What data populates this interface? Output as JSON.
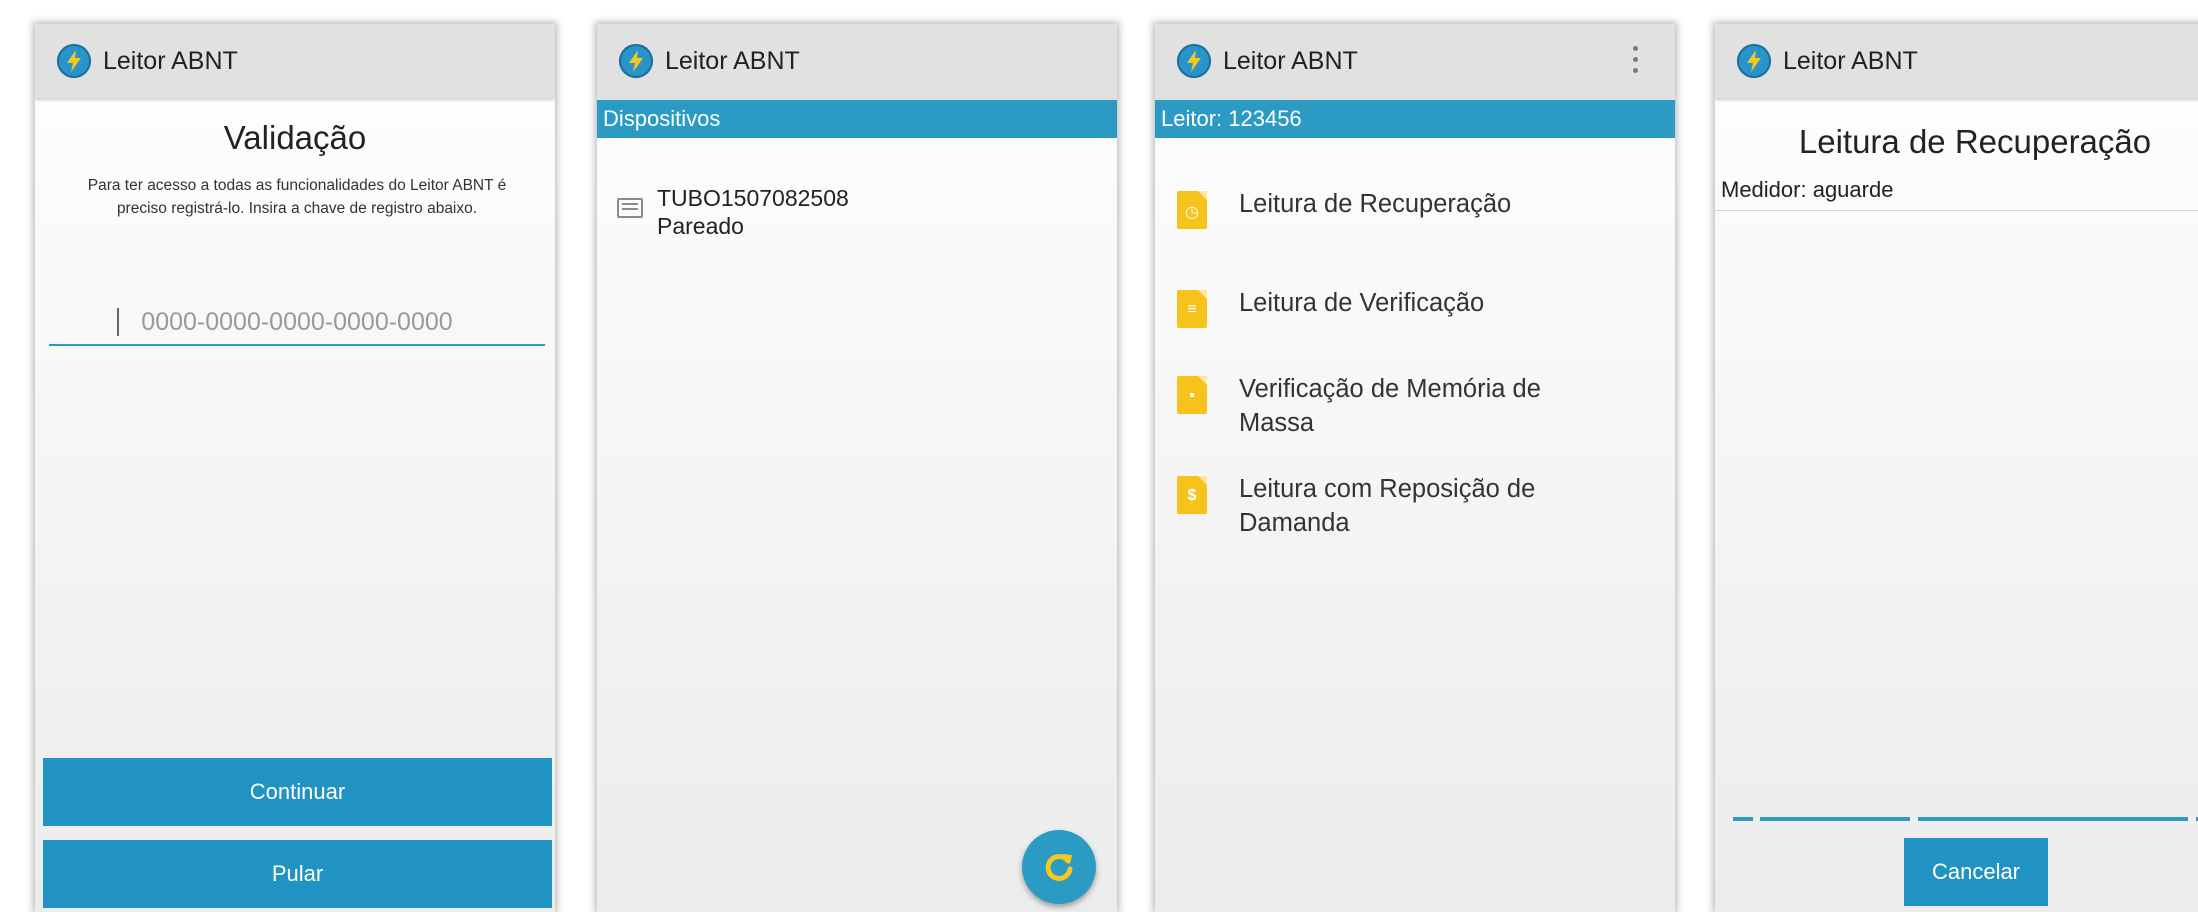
{
  "app": {
    "title": "Leitor ABNT"
  },
  "colors": {
    "accent": "#2b9bc3",
    "button": "#2093c2",
    "appbar": "#e1e1e1",
    "doc_icon": "#f6c31c"
  },
  "screen1": {
    "heading": "Validação",
    "description": "Para ter acesso a todas as funcionalidades do Leitor ABNT é preciso registrá-lo. Insira a chave de registro abaixo.",
    "key_input": {
      "placeholder": "0000-0000-0000-0000-0000",
      "value": ""
    },
    "continue_label": "Continuar",
    "skip_label": "Pular"
  },
  "screen2": {
    "section": "Dispositivos",
    "devices": [
      {
        "name": "TUBO1507082508",
        "status": "Pareado"
      }
    ],
    "fab_icon": "refresh-icon"
  },
  "screen3": {
    "section": "Leitor: 123456",
    "menu_icon": "overflow-menu-icon",
    "items": [
      {
        "label": "Leitura de Recuperação",
        "icon": "document-clock-icon"
      },
      {
        "label": "Leitura de Verificação",
        "icon": "document-lines-icon"
      },
      {
        "label": "Verificação de Memória de Massa",
        "icon": "document-chart-icon"
      },
      {
        "label": "Leitura com Reposição de Damanda",
        "icon": "document-dollar-icon"
      }
    ]
  },
  "screen4": {
    "heading": "Leitura de Recuperação",
    "meter": "Medidor: aguarde",
    "cancel_label": "Cancelar"
  }
}
